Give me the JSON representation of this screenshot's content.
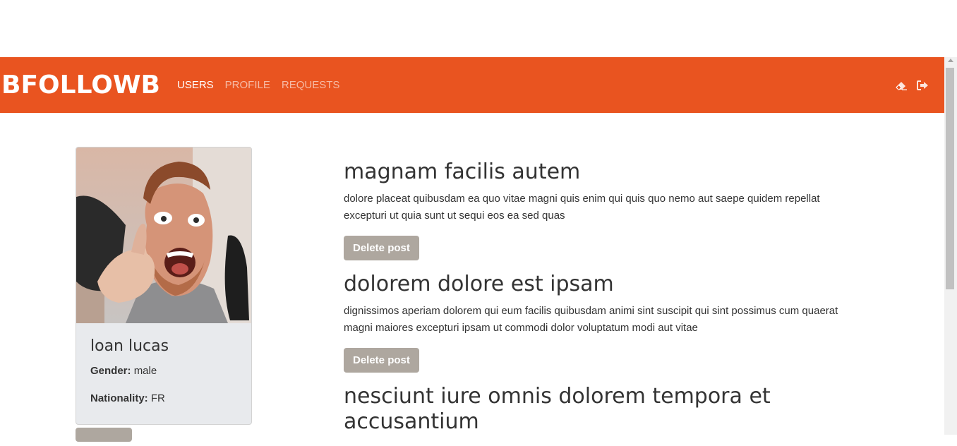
{
  "nav": {
    "brand": "BFOLLOWB",
    "links": [
      {
        "label": "USERS",
        "active": true
      },
      {
        "label": "PROFILE",
        "active": false
      },
      {
        "label": "REQUESTS",
        "active": false
      }
    ],
    "icons": [
      "eraser-icon",
      "sign-out-icon"
    ]
  },
  "colors": {
    "primary": "#e95420",
    "secondary": "#aea79f",
    "card_bg": "#e8eaed"
  },
  "profile": {
    "name": "loan lucas",
    "gender_label": "Gender:",
    "gender": "male",
    "nationality_label": "Nationality:",
    "nationality": "FR"
  },
  "posts": [
    {
      "title": "magnam facilis autem",
      "body": "dolore placeat quibusdam ea quo vitae magni quis enim qui quis quo nemo aut saepe quidem repellat excepturi ut quia sunt ut sequi eos ea sed quas",
      "button": "Delete post"
    },
    {
      "title": "dolorem dolore est ipsam",
      "body": "dignissimos aperiam dolorem qui eum facilis quibusdam animi sint suscipit qui sint possimus cum quaerat magni maiores excepturi ipsam ut commodi dolor voluptatum modi aut vitae",
      "button": "Delete post"
    },
    {
      "title": "nesciunt iure omnis dolorem tempora et accusantium",
      "body": "",
      "button": ""
    }
  ]
}
